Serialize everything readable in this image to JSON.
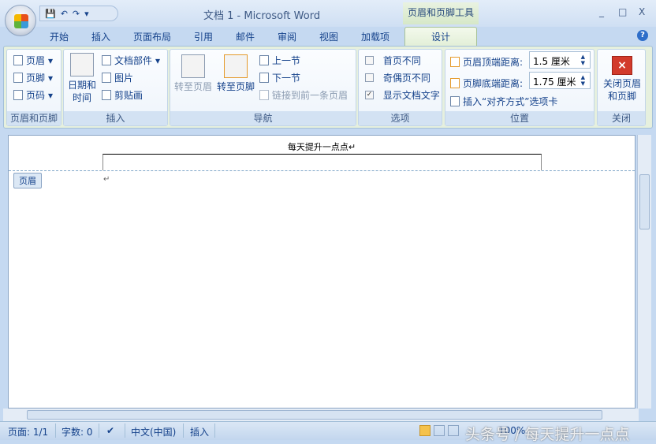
{
  "window": {
    "title": "文档 1 - Microsoft Word",
    "context_tab": "页眉和页脚工具",
    "minimize": "_",
    "maximize": "□",
    "close": "X"
  },
  "qat": {
    "save": "💾",
    "undo": "↶",
    "redo": "↷",
    "more": "▾"
  },
  "tabs": [
    "开始",
    "插入",
    "页面布局",
    "引用",
    "邮件",
    "审阅",
    "视图",
    "加载项",
    "设计"
  ],
  "help": "?",
  "groups": {
    "header_footer": {
      "label": "页眉和页脚",
      "items": [
        "页眉",
        "页脚",
        "页码"
      ]
    },
    "insert": {
      "label": "插入",
      "datetime": "日期和\n时间",
      "items": [
        "文档部件",
        "图片",
        "剪贴画"
      ]
    },
    "navigation": {
      "label": "导航",
      "goto_header": "转至页眉",
      "goto_footer": "转至页脚",
      "prev": "上一节",
      "next": "下一节",
      "link": "链接到前一条页眉"
    },
    "options": {
      "label": "选项",
      "items": [
        {
          "label": "首页不同",
          "checked": false
        },
        {
          "label": "奇偶页不同",
          "checked": false
        },
        {
          "label": "显示文档文字",
          "checked": true
        }
      ]
    },
    "position": {
      "label": "位置",
      "header_top": "页眉顶端距离:",
      "header_top_value": "1.5 厘米",
      "footer_bottom": "页脚底端距离:",
      "footer_bottom_value": "1.75 厘米",
      "insert_tab": "插入“对齐方式”选项卡"
    },
    "close": {
      "label": "关闭",
      "button": "关闭页眉和页脚"
    }
  },
  "document": {
    "header_text": "每天提升一点点↵",
    "header_tag": "页眉",
    "body_mark": "↵"
  },
  "status": {
    "page": "页面: 1/1",
    "words": "字数: 0",
    "language": "中文(中国)",
    "mode": "插入",
    "zoom": "100%"
  },
  "watermark": "头条号 / 每天提升一点点"
}
